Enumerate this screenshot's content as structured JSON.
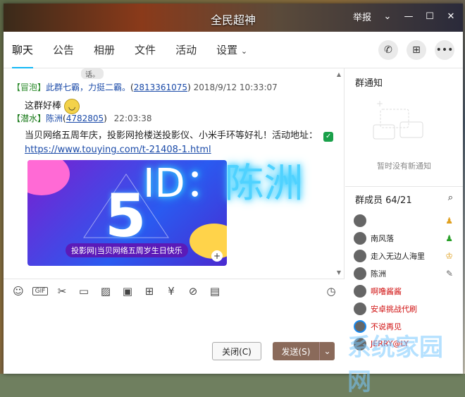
{
  "window": {
    "title": "全民超神",
    "report": "举报"
  },
  "tabs": [
    "聊天",
    "公告",
    "相册",
    "文件",
    "活动",
    "设置"
  ],
  "chat": {
    "top_partial": "话。",
    "msg1": {
      "tag": "【冒泡】",
      "name": "此群七霸，力挺二霸。",
      "id": "2813361075",
      "time": "2018/9/12 10:33:07",
      "text": "这群好棒"
    },
    "msg2": {
      "tag": "【潜水】",
      "name": "陈洲",
      "id": "4782805",
      "time": "22:03:38",
      "text": "当贝网络五周年庆，投影网抢楼送投影仪、小米手环等好礼！活动地址：",
      "link": "https://www.touying.com/t-21408-1.html"
    },
    "banner": {
      "number": "5",
      "caption": "投影网|当贝网络五周岁生日快乐"
    },
    "overlay": {
      "id": "ID：",
      "name": "陈洲"
    }
  },
  "buttons": {
    "close": "关闭(C)",
    "send": "发送(S)"
  },
  "notice": {
    "header": "群通知",
    "empty": "暂时没有新通知"
  },
  "members": {
    "header": "群成员 64/21",
    "list": [
      {
        "name": "",
        "color": "#333"
      },
      {
        "name": "南风落",
        "color": "#333"
      },
      {
        "name": "走入无边人海里",
        "color": "#333"
      },
      {
        "name": "陈洲",
        "color": "#333"
      },
      {
        "name": "啊噜酱酱",
        "color": "#d01010"
      },
      {
        "name": "安卓挑战代刷",
        "color": "#d01010"
      },
      {
        "name": "不说再见",
        "color": "#d01010"
      },
      {
        "name": "JERRY@LY",
        "color": "#d01010"
      }
    ]
  },
  "watermark": "系统家园网"
}
